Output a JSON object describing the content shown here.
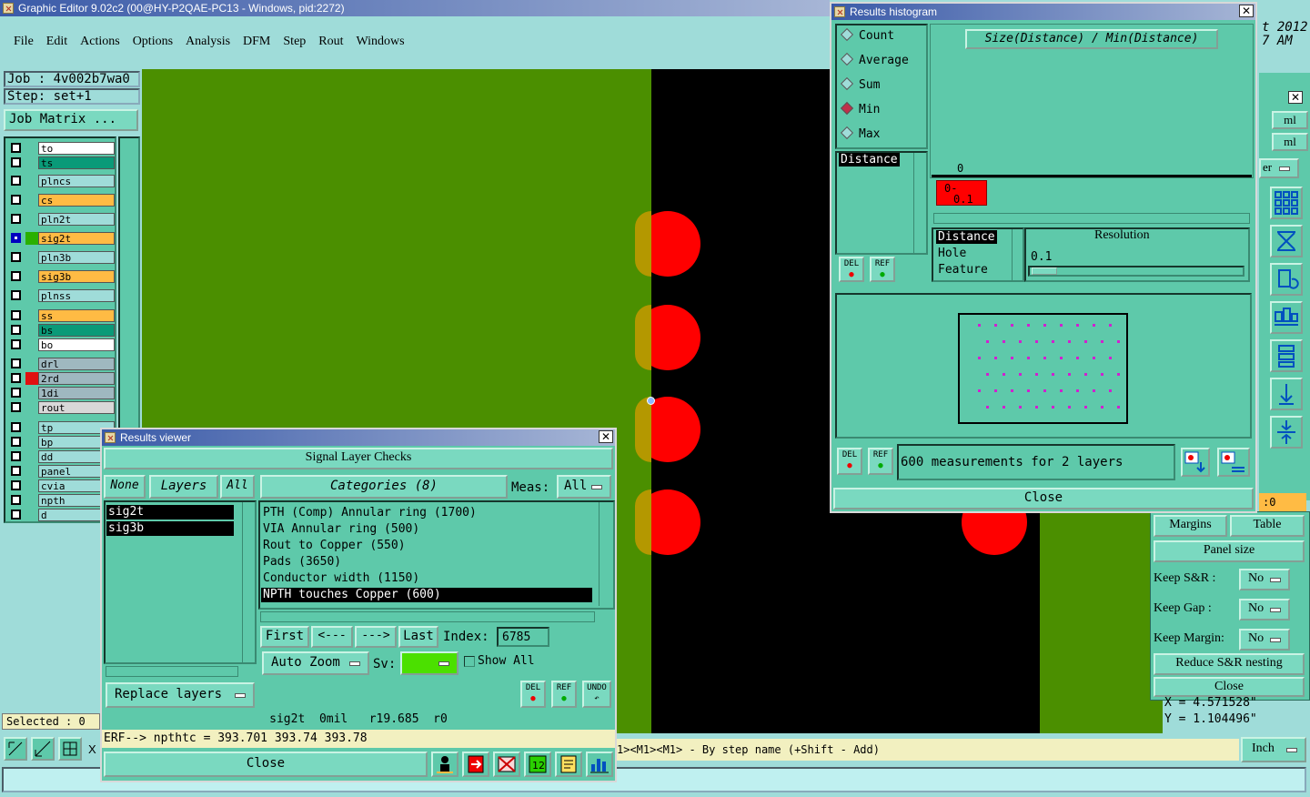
{
  "main_window": {
    "title": "Graphic Editor 9.02c2 (00@HY-P2QAE-PC13 - Windows, pid:2272)",
    "menu": [
      "File",
      "Edit",
      "Actions",
      "Options",
      "Analysis",
      "DFM",
      "Step",
      "Rout",
      "Windows"
    ],
    "job": "Job : 4v002b7wa0",
    "step": "Step: set+1",
    "job_matrix": "Job Matrix ...",
    "selected": "Selected : 0",
    "status_hint": "1><M1><M1> - By step name (+Shift - Add)",
    "units": "Inch",
    "x_label": "X",
    "clock_year": "t 2012",
    "clock_time": "7 AM",
    "coords": {
      "x": "X = 4.571528\"",
      "y": "Y = 1.104496\""
    },
    "side_ml1": "ml",
    "side_ml2": "ml",
    "side_er": "er",
    "zero_field": ":0"
  },
  "layers": [
    {
      "name": "to",
      "color": "#ffffff",
      "selected": false,
      "marker": false
    },
    {
      "name": "ts",
      "color": "#0a9a78",
      "selected": false,
      "marker": false
    },
    {
      "name": "plncs",
      "color": "#9fdcd9",
      "selected": false,
      "marker": false
    },
    {
      "name": "cs",
      "color": "#ffbb44",
      "selected": false,
      "marker": false
    },
    {
      "name": "pln2t",
      "color": "#9fdcd9",
      "selected": false,
      "marker": false
    },
    {
      "name": "sig2t",
      "color": "#ffbb44",
      "selected": true,
      "marker": false
    },
    {
      "name": "pln3b",
      "color": "#9fdcd9",
      "selected": false,
      "marker": false
    },
    {
      "name": "sig3b",
      "color": "#ffbb44",
      "selected": false,
      "marker": false
    },
    {
      "name": "plnss",
      "color": "#9fdcd9",
      "selected": false,
      "marker": false
    },
    {
      "name": "ss",
      "color": "#ffbb44",
      "selected": false,
      "marker": false
    },
    {
      "name": "bs",
      "color": "#0a9a78",
      "selected": false,
      "marker": false
    },
    {
      "name": "bo",
      "color": "#ffffff",
      "selected": false,
      "marker": false
    },
    {
      "name": "drl",
      "color": "#9fb8c0",
      "selected": false,
      "marker": false
    },
    {
      "name": "2rd",
      "color": "#9fb8c0",
      "selected": false,
      "marker": true
    },
    {
      "name": "1di",
      "color": "#9fb8c0",
      "selected": false,
      "marker": false
    },
    {
      "name": "rout",
      "color": "#d8d8d8",
      "selected": false,
      "marker": false
    },
    {
      "name": "tp",
      "color": "#9fdcd9",
      "selected": false,
      "marker": false
    },
    {
      "name": "bp",
      "color": "#9fdcd9",
      "selected": false,
      "marker": false
    },
    {
      "name": "dd",
      "color": "#9fdcd9",
      "selected": false,
      "marker": false
    },
    {
      "name": "panel",
      "color": "#9fdcd9",
      "selected": false,
      "marker": false
    },
    {
      "name": "cvia",
      "color": "#9fdcd9",
      "selected": false,
      "marker": false
    },
    {
      "name": "npth",
      "color": "#9fdcd9",
      "selected": false,
      "marker": false
    },
    {
      "name": "d",
      "color": "#9fdcd9",
      "selected": false,
      "marker": false
    }
  ],
  "results_viewer": {
    "title": "Results viewer",
    "header": "Signal Layer Checks",
    "none_btn": "None",
    "layers_label": "Layers",
    "all_btn": "All",
    "layers": [
      "sig2t",
      "sig3b"
    ],
    "categories_label": "Categories (8)",
    "meas_label": "Meas:",
    "meas_value": "All",
    "categories": [
      "PTH (Comp) Annular ring (1700)",
      "VIA Annular ring (500)",
      "Rout to Copper (550)",
      "Pads (3650)",
      "Conductor width (1150)",
      "NPTH touches Copper (600)"
    ],
    "selected_category": 5,
    "first": "First",
    "prev": "<---",
    "next": "--->",
    "last": "Last",
    "index_label": "Index:",
    "index_value": "6785",
    "auto_zoom": "Auto Zoom",
    "sv_label": "Sv:",
    "show_all": "Show All",
    "replace_layers": "Replace layers",
    "del": "DEL",
    "ref": "REF",
    "undo": "UNDO",
    "info_line": "sig2t  0mil   r19.685  r0",
    "erf_line": "ERF--> npthtc = 393.701 393.74 393.78",
    "close": "Close"
  },
  "results_histogram": {
    "title": "Results histogram",
    "modes": [
      "Count",
      "Average",
      "Sum",
      "Min",
      "Max"
    ],
    "selected_mode": "Min",
    "formula": "Size(Distance) / Min(Distance)",
    "field_list": [
      "Distance"
    ],
    "axis_zero": "0",
    "bar_label_1": "0-",
    "bar_label_2": "0.1",
    "sort_fields": [
      "Distance",
      "Hole",
      "Feature"
    ],
    "resolution_label": "Resolution",
    "resolution_value": "0.1",
    "del": "DEL",
    "ref": "REF",
    "summary": "600 measurements for 2 layers",
    "close": "Close"
  },
  "panelize": {
    "margins": "Margins",
    "table": "Table",
    "panel_size": "Panel size",
    "keep_sr": "Keep S&R  :",
    "keep_sr_val": "No",
    "keep_gap": "Keep Gap   :",
    "keep_gap_val": "No",
    "keep_margin": "Keep Margin:",
    "keep_margin_val": "No",
    "reduce": "Reduce S&R nesting",
    "close": "Close"
  },
  "colors": {
    "green_copper": "#4b8f00",
    "pad_red": "#ff0000",
    "bg_panel": "#5ec9aa",
    "app_bg": "#9fdcd9"
  }
}
